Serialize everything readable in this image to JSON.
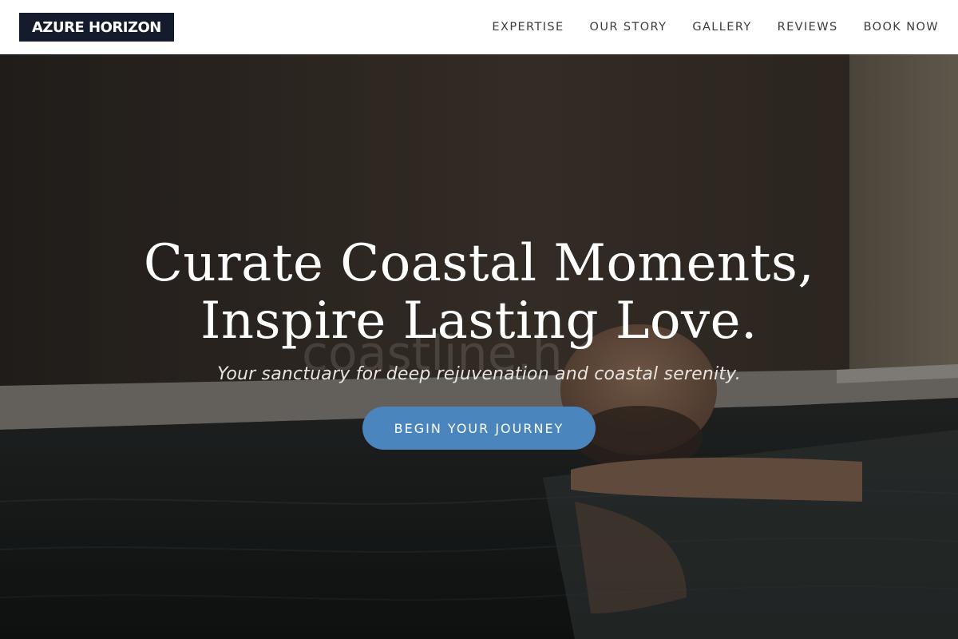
{
  "brand": {
    "logo_text": "AZURE HORIZON"
  },
  "nav": {
    "items": [
      {
        "label": "EXPERTISE"
      },
      {
        "label": "OUR STORY"
      },
      {
        "label": "GALLERY"
      },
      {
        "label": "REVIEWS"
      },
      {
        "label": "BOOK NOW"
      }
    ]
  },
  "hero": {
    "headline_line1": "Curate Coastal Moments,",
    "headline_line2": "Inspire Lasting Love.",
    "subheadline": "Your sanctuary for deep rejuvenation and coastal serenity.",
    "cta_label": "BEGIN YOUR JOURNEY",
    "watermark_text": "coastline.h"
  },
  "colors": {
    "logo_bg": "#141b2d",
    "cta_bg": "#4a85bd",
    "nav_text": "#3b3b3b"
  }
}
